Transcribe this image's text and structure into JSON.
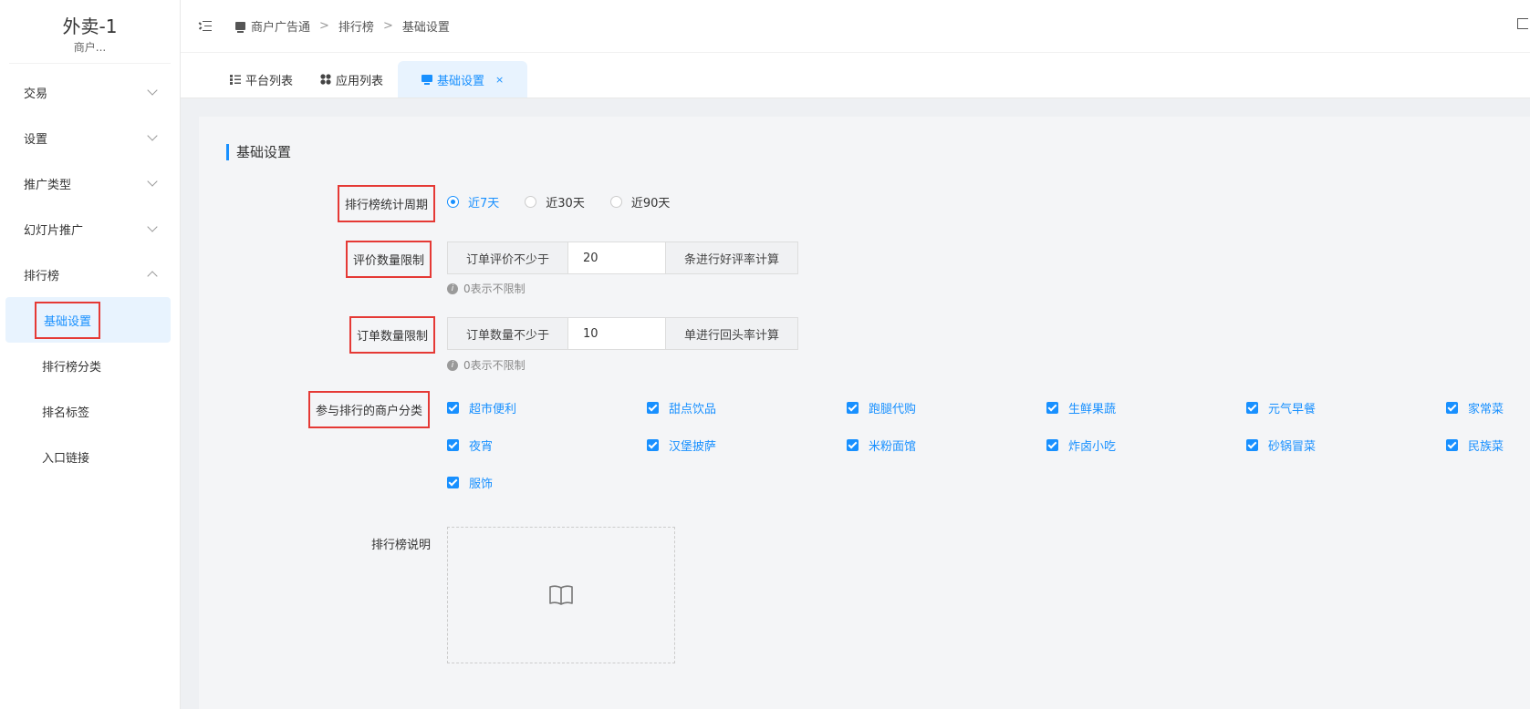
{
  "sidebar": {
    "brand_title": "外卖-1",
    "brand_sub": "商户...",
    "menu": [
      {
        "label": "交易"
      },
      {
        "label": "设置"
      },
      {
        "label": "推广类型"
      },
      {
        "label": "幻灯片推广"
      },
      {
        "label": "排行榜"
      }
    ],
    "submenu": [
      {
        "label": "基础设置"
      },
      {
        "label": "排行榜分类"
      },
      {
        "label": "排名标签"
      },
      {
        "label": "入口链接"
      }
    ]
  },
  "breadcrumb": [
    "商户广告通",
    "排行榜",
    "基础设置"
  ],
  "tabs": [
    {
      "label": "平台列表"
    },
    {
      "label": "应用列表"
    },
    {
      "label": "基础设置",
      "close": "×"
    }
  ],
  "form": {
    "section_title": "基础设置",
    "period_label": "排行榜统计周期",
    "period_options": [
      "近7天",
      "近30天",
      "近90天"
    ],
    "rating_label": "评价数量限制",
    "rating_prefix": "订单评价不少于",
    "rating_value": "20",
    "rating_suffix": "条进行好评率计算",
    "rating_hint": "0表示不限制",
    "order_label": "订单数量限制",
    "order_prefix": "订单数量不少于",
    "order_value": "10",
    "order_suffix": "单进行回头率计算",
    "order_hint": "0表示不限制",
    "category_label": "参与排行的商户分类",
    "categories": [
      "超市便利",
      "甜点饮品",
      "跑腿代购",
      "生鲜果蔬",
      "元气早餐",
      "家常菜",
      "夜宵",
      "汉堡披萨",
      "米粉面馆",
      "炸卤小吃",
      "砂锅冒菜",
      "民族菜",
      "服饰"
    ],
    "desc_label": "排行榜说明"
  },
  "colors": {
    "accent": "#1890ff",
    "highlight": "#e53935"
  }
}
